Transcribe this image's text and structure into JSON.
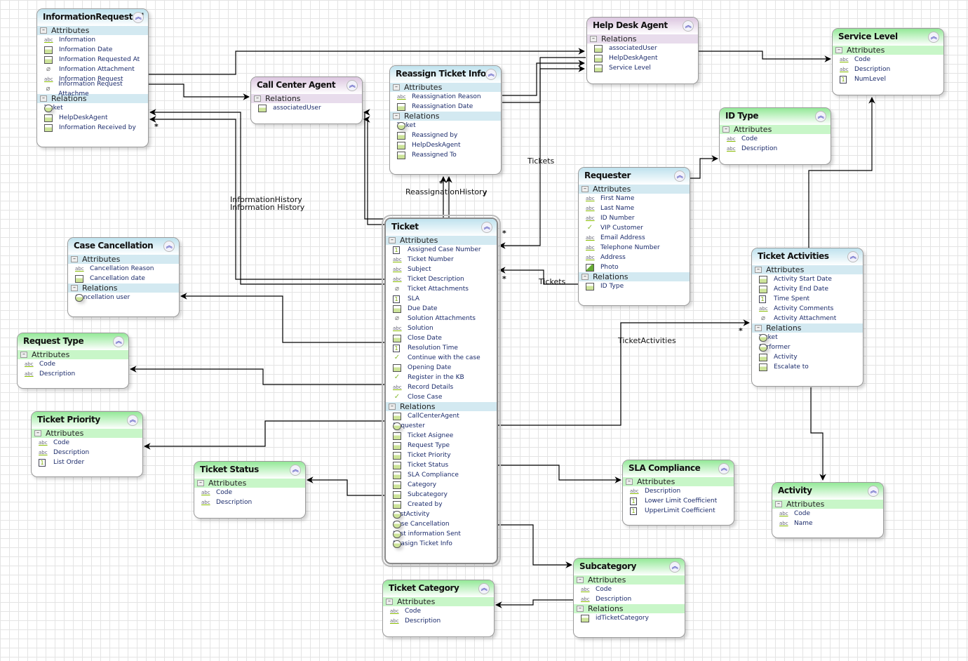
{
  "entities": [
    {
      "id": "information-requested",
      "name": "InformationRequested",
      "theme": "blue",
      "sections": [
        {
          "label": "Attributes",
          "items": [
            [
              "abc",
              "Information"
            ],
            [
              "date",
              "Information Date"
            ],
            [
              "date",
              "Information Requested At"
            ],
            [
              "clip",
              "Information Attachment"
            ],
            [
              "abc",
              "Information Request"
            ],
            [
              "clip",
              "Information Request Attachme"
            ]
          ]
        },
        {
          "label": "Relations",
          "items": [
            [
              "ent",
              "Ticket"
            ],
            [
              "usr",
              "HelpDeskAgent"
            ],
            [
              "usr",
              "Information Received by"
            ]
          ]
        }
      ]
    },
    {
      "id": "call-center-agent",
      "name": "Call Center Agent",
      "theme": "purple",
      "sections": [
        {
          "label": "Relations",
          "items": [
            [
              "usr",
              "associatedUser"
            ]
          ]
        }
      ]
    },
    {
      "id": "reassign-ticket-info",
      "name": "Reassign Ticket Info",
      "theme": "blue",
      "sections": [
        {
          "label": "Attributes",
          "items": [
            [
              "abc",
              "Reassignation Reason"
            ],
            [
              "date",
              "Reassignation Date"
            ]
          ]
        },
        {
          "label": "Relations",
          "items": [
            [
              "ent",
              "Ticket"
            ],
            [
              "usr",
              "Reassigned by"
            ],
            [
              "usr",
              "HelpDeskAgent"
            ],
            [
              "usr",
              "Reassigned To"
            ]
          ]
        }
      ]
    },
    {
      "id": "help-desk-agent",
      "name": "Help Desk Agent",
      "theme": "purple",
      "sections": [
        {
          "label": "Relations",
          "items": [
            [
              "usr",
              "associatedUser"
            ],
            [
              "usr",
              "HelpDeskAgent"
            ],
            [
              "tbl",
              "Service Level"
            ]
          ]
        }
      ]
    },
    {
      "id": "service-level",
      "name": "Service Level",
      "theme": "green",
      "sections": [
        {
          "label": "Attributes",
          "items": [
            [
              "abc",
              "Code"
            ],
            [
              "abc",
              "Description"
            ],
            [
              "num",
              "NumLevel"
            ]
          ]
        }
      ]
    },
    {
      "id": "id-type",
      "name": "ID Type",
      "theme": "green",
      "sections": [
        {
          "label": "Attributes",
          "items": [
            [
              "abc",
              "Code"
            ],
            [
              "abc",
              "Description"
            ]
          ]
        }
      ]
    },
    {
      "id": "requester",
      "name": "Requester",
      "theme": "blue",
      "sections": [
        {
          "label": "Attributes",
          "items": [
            [
              "abc",
              "First Name"
            ],
            [
              "abc",
              "Last Name"
            ],
            [
              "abc",
              "ID Number"
            ],
            [
              "chk",
              "VIP Customer"
            ],
            [
              "abc",
              "Email Address"
            ],
            [
              "abc",
              "Telephone Number"
            ],
            [
              "abc",
              "Address"
            ],
            [
              "pic",
              "Photo"
            ]
          ]
        },
        {
          "label": "Relations",
          "items": [
            [
              "tbl",
              "ID Type"
            ]
          ]
        }
      ]
    },
    {
      "id": "ticket",
      "name": "Ticket",
      "theme": "blue",
      "sections": [
        {
          "label": "Attributes",
          "items": [
            [
              "num",
              "Assigned Case Number"
            ],
            [
              "abc",
              "Ticket Number"
            ],
            [
              "abc",
              "Subject"
            ],
            [
              "abc",
              "Ticket Description"
            ],
            [
              "clip",
              "Ticket Attachments"
            ],
            [
              "num",
              "SLA"
            ],
            [
              "date",
              "Due Date"
            ],
            [
              "clip",
              "Solution Attachments"
            ],
            [
              "abc",
              "Solution"
            ],
            [
              "date",
              "Close Date"
            ],
            [
              "num",
              "Resolution Time"
            ],
            [
              "chk",
              "Continue with the case"
            ],
            [
              "date",
              "Opening Date"
            ],
            [
              "chk",
              "Register in the KB"
            ],
            [
              "abc",
              "Record Details"
            ],
            [
              "chk",
              "Close Case"
            ]
          ]
        },
        {
          "label": "Relations",
          "items": [
            [
              "usr",
              "CallCenterAgent"
            ],
            [
              "ent",
              "Requester"
            ],
            [
              "usr",
              "Ticket Asignee"
            ],
            [
              "tbl",
              "Request Type"
            ],
            [
              "tbl",
              "Ticket Priority"
            ],
            [
              "tbl",
              "Ticket Status"
            ],
            [
              "tbl",
              "SLA Compliance"
            ],
            [
              "tbl",
              "Category"
            ],
            [
              "tbl",
              "Subcategory"
            ],
            [
              "usr",
              "Created by"
            ],
            [
              "ent",
              "LastActivity"
            ],
            [
              "ent",
              "Case Cancellation"
            ],
            [
              "ent",
              "Last information Sent"
            ],
            [
              "ent",
              "Reasign Ticket Info"
            ]
          ]
        }
      ]
    },
    {
      "id": "case-cancellation",
      "name": "Case Cancellation",
      "theme": "blue",
      "sections": [
        {
          "label": "Attributes",
          "items": [
            [
              "abc",
              "Cancellation Reason"
            ],
            [
              "date",
              "Cancellation date"
            ]
          ]
        },
        {
          "label": "Relations",
          "items": [
            [
              "ent",
              "Cancellation user"
            ]
          ]
        }
      ]
    },
    {
      "id": "request-type",
      "name": "Request Type",
      "theme": "green",
      "sections": [
        {
          "label": "Attributes",
          "items": [
            [
              "abc",
              "Code"
            ],
            [
              "abc",
              "Description"
            ]
          ]
        }
      ]
    },
    {
      "id": "ticket-priority",
      "name": "Ticket Priority",
      "theme": "green",
      "sections": [
        {
          "label": "Attributes",
          "items": [
            [
              "abc",
              "Code"
            ],
            [
              "abc",
              "Description"
            ],
            [
              "num",
              "List Order"
            ]
          ]
        }
      ]
    },
    {
      "id": "ticket-status",
      "name": "Ticket Status",
      "theme": "green",
      "sections": [
        {
          "label": "Attributes",
          "items": [
            [
              "abc",
              "Code"
            ],
            [
              "abc",
              "Description"
            ]
          ]
        }
      ]
    },
    {
      "id": "sla-compliance",
      "name": "SLA Compliance",
      "theme": "green",
      "sections": [
        {
          "label": "Attributes",
          "items": [
            [
              "abc",
              "Description"
            ],
            [
              "num",
              "Lower Limit Coefficient"
            ],
            [
              "num",
              "UpperLimit Coefficient"
            ]
          ]
        }
      ]
    },
    {
      "id": "ticket-activities",
      "name": "Ticket Activities",
      "theme": "blue",
      "sections": [
        {
          "label": "Attributes",
          "items": [
            [
              "date",
              "Activity Start Date"
            ],
            [
              "date",
              "Activity End Date"
            ],
            [
              "num",
              "Time Spent"
            ],
            [
              "abc",
              "Activity Comments"
            ],
            [
              "clip",
              "Activity Attachment"
            ]
          ]
        },
        {
          "label": "Relations",
          "items": [
            [
              "ent",
              "Ticket"
            ],
            [
              "ent",
              "Performer"
            ],
            [
              "tbl",
              "Activity"
            ],
            [
              "tbl",
              "Escalate to"
            ]
          ]
        }
      ]
    },
    {
      "id": "activity",
      "name": "Activity",
      "theme": "green",
      "sections": [
        {
          "label": "Attributes",
          "items": [
            [
              "abc",
              "Code"
            ],
            [
              "abc",
              "Name"
            ]
          ]
        }
      ]
    },
    {
      "id": "subcategory",
      "name": "Subcategory",
      "theme": "green",
      "sections": [
        {
          "label": "Attributes",
          "items": [
            [
              "abc",
              "Code"
            ],
            [
              "abc",
              "Description"
            ]
          ]
        },
        {
          "label": "Relations",
          "items": [
            [
              "tbl",
              "idTicketCategory"
            ]
          ]
        }
      ]
    },
    {
      "id": "ticket-category",
      "name": "Ticket Category",
      "theme": "green",
      "sections": [
        {
          "label": "Attributes",
          "items": [
            [
              "abc",
              "Code"
            ],
            [
              "abc",
              "Description"
            ]
          ]
        }
      ]
    }
  ],
  "connector_labels": {
    "tickets_1": "Tickets",
    "information_history_1": "InformationHistory",
    "information_history_2": "Information History",
    "reassignation_history": "ReassignationHistory",
    "reassignation_history_y": "y",
    "tickets_2": "Tickets",
    "ticket_activities": "TicketActivities",
    "many": "*"
  },
  "theme_colors": {
    "blue": "#bfe2ee",
    "purple": "#dcc6e0",
    "green": "#94e998"
  }
}
